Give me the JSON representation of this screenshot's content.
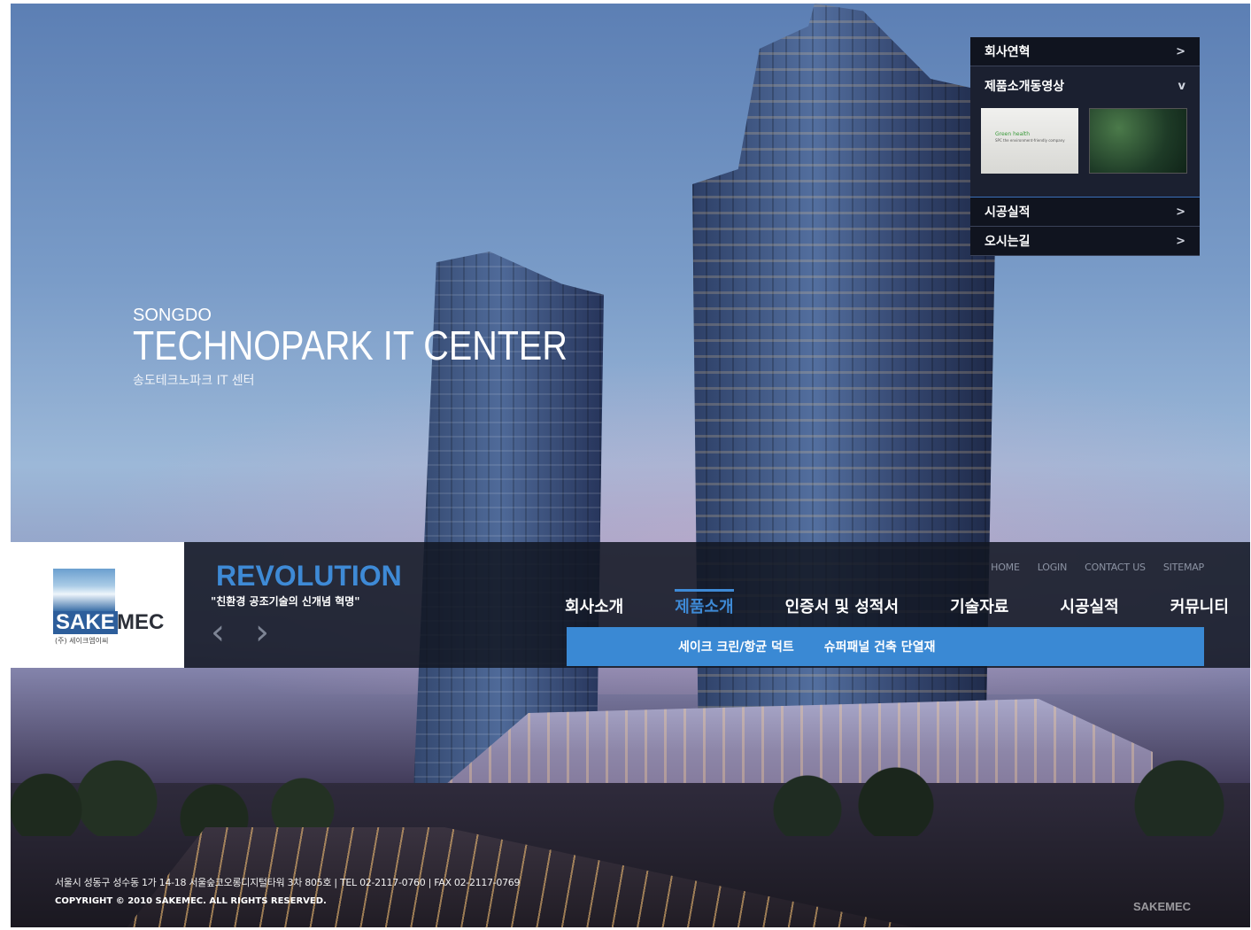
{
  "hero": {
    "subtitle": "SONGDO",
    "title": "TECHNOPARK IT CENTER",
    "korean": "송도테크노파크 IT 센터"
  },
  "panel": {
    "history": "회사연혁",
    "video": "제품소개동영상",
    "thumb1_title": "Green health",
    "thumb1_sub": "SPC the environment-friendly company",
    "construction": "시공실적",
    "directions": "오시는길",
    "chevron_right": ">",
    "chevron_down": "v"
  },
  "logo": {
    "sake": "SAKE",
    "mec": "MEC",
    "korean": "(주) 세이크엠이씨"
  },
  "banner": {
    "title": "REVOLUTION",
    "subtitle": "\"친환경 공조기술의 신개념 혁명\"",
    "prev": "‹",
    "next": "›"
  },
  "util": {
    "home": "HOME",
    "login": "LOGIN",
    "contact": "CONTACT US",
    "sitemap": "SITEMAP"
  },
  "nav": {
    "items": [
      "회사소개",
      "제품소개",
      "인증서 및 성적서",
      "기술자료",
      "시공실적",
      "커뮤니티"
    ],
    "active_index": 1
  },
  "subnav": {
    "items": [
      "세이크 크린/항균 덕트",
      "슈퍼패널 건축 단열재"
    ]
  },
  "footer": {
    "address": "서울시 성동구 성수동 1가 14-18 서울숲코오롱디지털타워 3차 805호 | TEL 02-2117-0760 | FAX 02-2117-0769",
    "copyright": "COPYRIGHT © 2010 SAKEMEC. ALL RIGHTS RESERVED.",
    "watermark": "SAKEMEC"
  },
  "colors": {
    "accent": "#3e8ad6",
    "panel_bg": "#1b2030",
    "bar_bg": "#121622"
  }
}
